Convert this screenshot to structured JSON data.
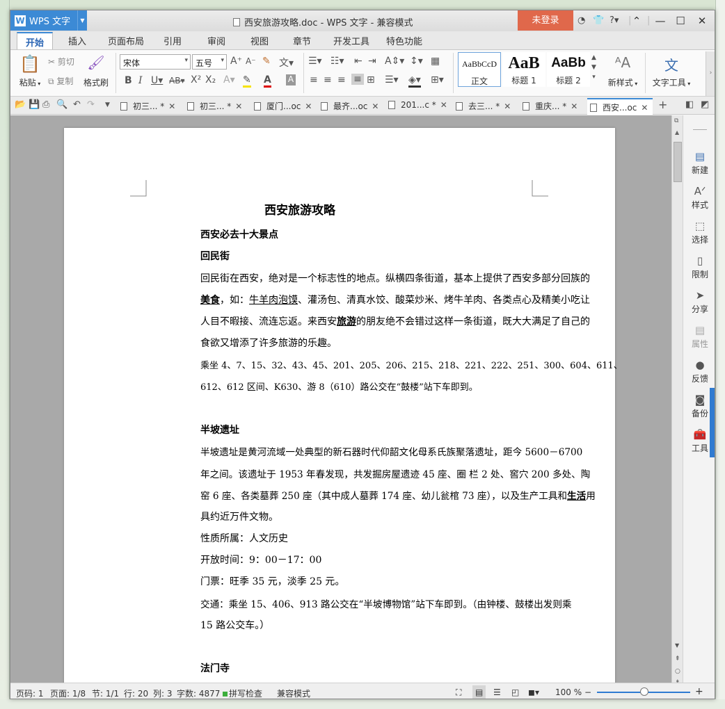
{
  "window": {
    "app_button": "WPS 文字",
    "title": "西安旅游攻略.doc - WPS 文字 - 兼容模式",
    "login": "未登录"
  },
  "menu_tabs": [
    "开始",
    "插入",
    "页面布局",
    "引用",
    "审阅",
    "视图",
    "章节",
    "开发工具",
    "特色功能"
  ],
  "ribbon": {
    "paste": "粘贴",
    "cut": "剪切",
    "copy": "复制",
    "format_painter": "格式刷",
    "font_name": "宋体",
    "font_size": "五号",
    "styles": [
      {
        "preview": "AaBbCcD",
        "name": "正文"
      },
      {
        "preview": "AaB",
        "name": "标题 1"
      },
      {
        "preview": "AaBb",
        "name": "标题 2"
      }
    ],
    "new_style": "新样式",
    "text_tools": "文字工具"
  },
  "doc_tabs": [
    {
      "label": "初三...",
      "mark": "*"
    },
    {
      "label": "初三...",
      "mark": "*"
    },
    {
      "label": "厦门...oc",
      "mark": ""
    },
    {
      "label": "最齐...oc",
      "mark": ""
    },
    {
      "label": "201...c",
      "mark": "*"
    },
    {
      "label": "去三...",
      "mark": "*"
    },
    {
      "label": "重庆...",
      "mark": "*"
    },
    {
      "label": "西安...oc",
      "mark": ""
    }
  ],
  "document": {
    "title": "西安旅游攻略",
    "h1": "西安必去十大景点",
    "s1_title": "回民街",
    "s1_l1": "回民街在西安，绝对是一个标志性的地点。纵横四条街道，基本上提供了西安多部分回族的",
    "s1_l2a": "美食",
    "s1_l2b": "，如：",
    "s1_l2c": "牛羊肉泡馍",
    "s1_l2d": "、灌汤包、清真水饺、酸菜炒米、烤牛羊肉、各类点心及精美小吃让",
    "s1_l3a": "人目不暇接、流连忘返。来西安",
    "s1_l3b": "旅游",
    "s1_l3c": "的朋友绝不会错过这样一条街道，既大大满足了自己的",
    "s1_l4": "食欲又增添了许多旅游的乐趣。",
    "s1_l5": "乘坐 4、7、15、32、43、45、201、205、206、215、218、221、222、251、300、604、611、",
    "s1_l6": "612、612 区间、K630、游 8（610）路公交在“鼓楼”站下车即到。",
    "s2_title": "半坡遗址",
    "s2_l1": "半坡遗址是黄河流域一处典型的新石器时代仰韶文化母系氏族聚落遗址，距今 5600－6700",
    "s2_l2": "年之间。该遗址于 1953 年春发现，共发掘房屋遗迹 45 座、圈 栏 2 处、窖穴 200 多处、陶",
    "s2_l3a": "窑 6 座、各类墓葬 250 座（其中成人墓葬 174 座、幼儿瓮棺 73 座），以及生产工具和",
    "s2_l3b": "生活",
    "s2_l3c": "用",
    "s2_l4": "具约近万件文物。",
    "s2_l5": "性质所属：人文历史",
    "s2_l6": "开放时间：9：00－17：00",
    "s2_l7": "门票：旺季 35 元，淡季 25 元。",
    "s2_l8": "交通：乘坐 15、406、913 路公交在“半坡博物馆”站下车即到。（由钟楼、鼓楼出发则乘",
    "s2_l9": "15 路公交车。）",
    "s3_title": "法门寺"
  },
  "side_pane": [
    "新建",
    "样式",
    "选择",
    "限制",
    "分享",
    "属性",
    "反馈",
    "备份",
    "工具"
  ],
  "status": {
    "page_num": "页码: 1",
    "pages": "页面: 1/8",
    "section": "节: 1/1",
    "row": "行: 20",
    "col": "列: 3",
    "words": "字数: 4877",
    "spell": "拼写检查",
    "compat": "兼容模式",
    "zoom": "100 %"
  },
  "colors": {
    "accent": "#3c8ad5",
    "login": "#e0684b"
  }
}
